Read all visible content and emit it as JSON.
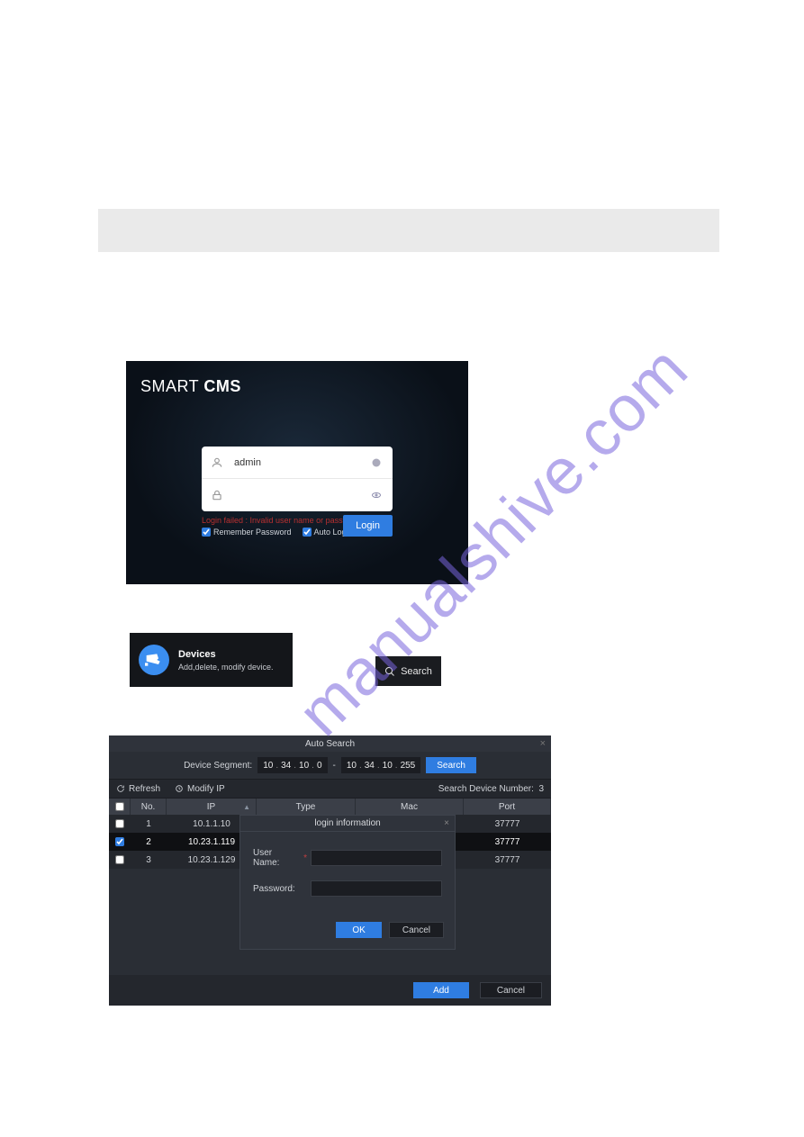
{
  "watermark": "manualshive.com",
  "login": {
    "brand_light": "SMART ",
    "brand_bold": "CMS",
    "username_value": "admin",
    "password_value": "",
    "error_text": "Login failed : Invalid user name or password.",
    "remember_label": "Remember Password",
    "auto_login_label": "Auto Login",
    "login_button": "Login"
  },
  "devices_card": {
    "title": "Devices",
    "subtitle": "Add,delete, modify device."
  },
  "search_button": "Search",
  "auto_search": {
    "title": "Auto Search",
    "segment_label": "Device Segment:",
    "ip_from": [
      "10",
      "34",
      "10",
      "0"
    ],
    "ip_to": [
      "10",
      "34",
      "10",
      "255"
    ],
    "segment_sep": "-",
    "search_btn": "Search",
    "refresh": "Refresh",
    "modify_ip": "Modify IP",
    "count_label": "Search Device Number:",
    "count_value": "3",
    "headers": {
      "no": "No.",
      "ip": "IP",
      "type": "Type",
      "mac": "Mac",
      "port": "Port"
    },
    "rows": [
      {
        "no": "1",
        "ip": "10.1.1.10",
        "type": "",
        "mac": "",
        "port": "37777",
        "checked": false,
        "selected": false
      },
      {
        "no": "2",
        "ip": "10.23.1.119",
        "type": "",
        "mac": "",
        "port": "37777",
        "checked": true,
        "selected": true
      },
      {
        "no": "3",
        "ip": "10.23.1.129",
        "type": "",
        "mac": "",
        "port": "37777",
        "checked": false,
        "selected": false
      }
    ],
    "login_info": {
      "title": "login information",
      "username_label": "User Name:",
      "password_label": "Password:",
      "username_value": "",
      "ok": "OK",
      "cancel": "Cancel"
    },
    "footer": {
      "add": "Add",
      "cancel": "Cancel"
    }
  }
}
